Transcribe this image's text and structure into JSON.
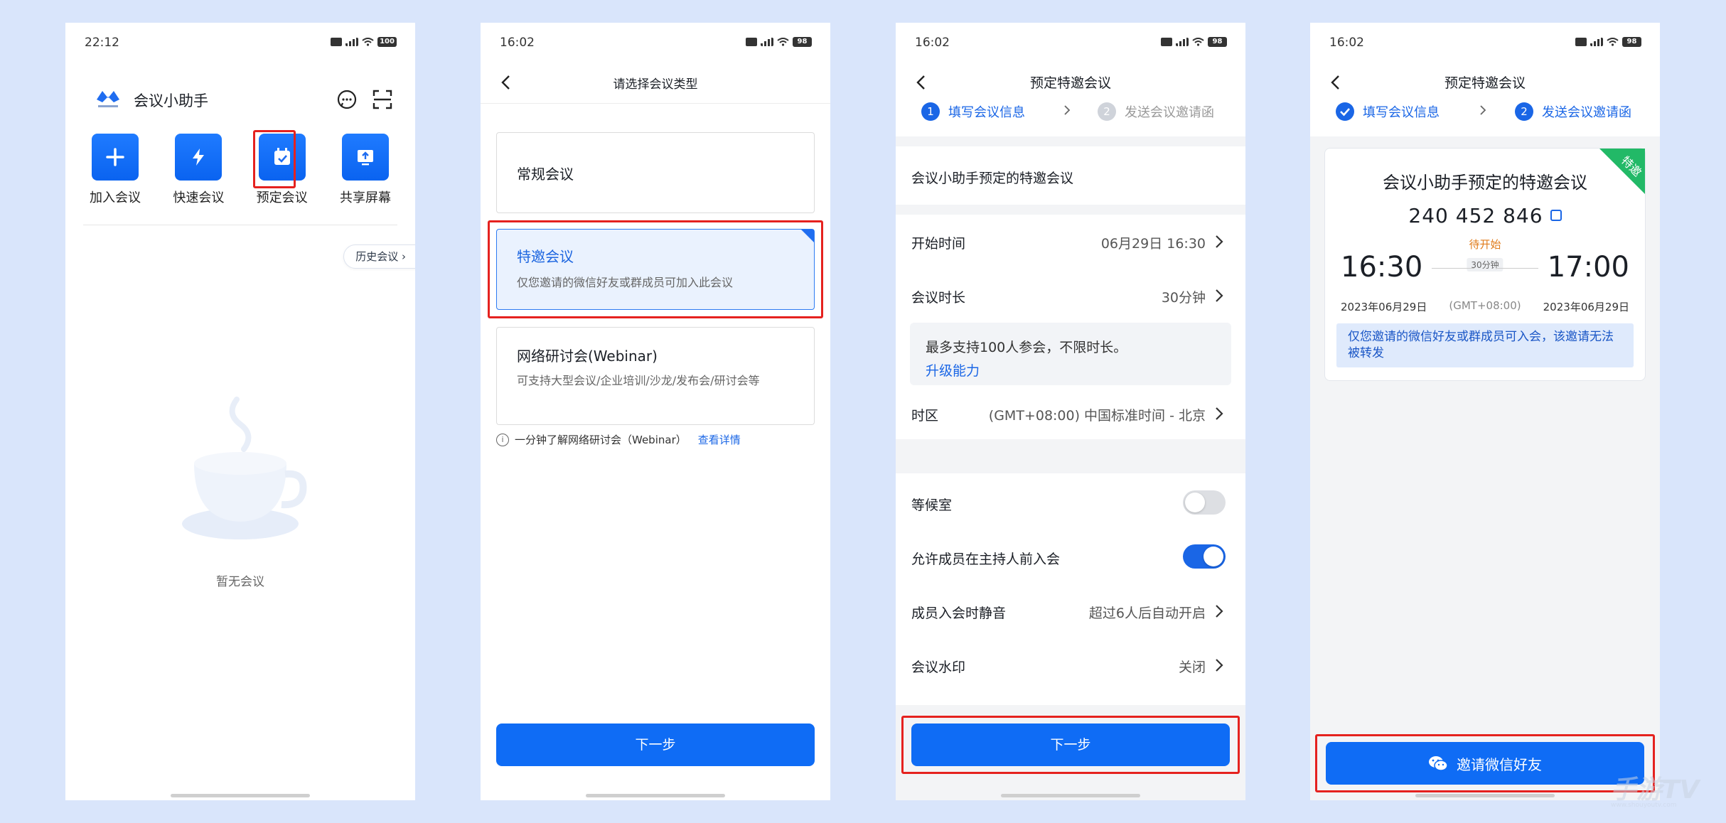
{
  "colors": {
    "page_bg": "#d9e5fb",
    "accent": "#0f6cf5",
    "highlight_border": "#e5221f",
    "special_tag": "#22b967"
  },
  "screen1": {
    "status": {
      "time": "22:12",
      "battery": "100"
    },
    "app_title": "会议小助手",
    "actions": [
      {
        "label": "加入会议",
        "icon": "plus-icon"
      },
      {
        "label": "快速会议",
        "icon": "lightning-icon"
      },
      {
        "label": "预定会议",
        "icon": "calendar-check-icon"
      },
      {
        "label": "共享屏幕",
        "icon": "share-screen-icon"
      }
    ],
    "history_button": "历史会议",
    "empty_text": "暂无会议"
  },
  "screen2": {
    "status": {
      "time": "16:02",
      "battery": "98"
    },
    "title": "请选择会议类型",
    "types": [
      {
        "title": "常规会议",
        "desc": ""
      },
      {
        "title": "特邀会议",
        "desc": "仅您邀请的微信好友或群成员可加入此会议"
      },
      {
        "title": "网络研讨会(Webinar)",
        "desc": "可支持大型会议/企业培训/沙龙/发布会/研讨会等"
      }
    ],
    "info_text": "一分钟了解网络研讨会（Webinar）",
    "info_link": "查看详情",
    "next_button": "下一步"
  },
  "screen3": {
    "status": {
      "time": "16:02",
      "battery": "98"
    },
    "title": "预定特邀会议",
    "steps": [
      {
        "num": "1",
        "label": "填写会议信息"
      },
      {
        "num": "2",
        "label": "发送会议邀请函"
      }
    ],
    "meeting_name": "会议小助手预定的特邀会议",
    "start_time": {
      "label": "开始时间",
      "value": "06月29日 16:30"
    },
    "duration": {
      "label": "会议时长",
      "value": "30分钟"
    },
    "tip": {
      "text": "最多支持100人参会，不限时长。",
      "link": "升级能力"
    },
    "timezone": {
      "label": "时区",
      "value": "(GMT+08:00) 中国标准时间 - 北京"
    },
    "waiting_room": {
      "label": "等候室",
      "on": false
    },
    "join_before_host": {
      "label": "允许成员在主持人前入会",
      "on": true
    },
    "mute_on_join": {
      "label": "成员入会时静音",
      "value": "超过6人后自动开启"
    },
    "watermark": {
      "label": "会议水印",
      "value": "关闭"
    },
    "next_button": "下一步"
  },
  "screen4": {
    "status": {
      "time": "16:02",
      "battery": "98"
    },
    "title": "预定特邀会议",
    "steps": [
      {
        "label": "填写会议信息"
      },
      {
        "num": "2",
        "label": "发送会议邀请函"
      }
    ],
    "card": {
      "badge": "特邀",
      "title": "会议小助手预定的特邀会议",
      "meeting_id": "240 452 846",
      "status": "待开始",
      "duration": "30分钟",
      "start_time": "16:30",
      "end_time": "17:00",
      "start_date": "2023年06月29日",
      "end_date": "2023年06月29日",
      "timezone": "(GMT+08:00)",
      "notice": "仅您邀请的微信好友或群成员可入会，该邀请无法被转发"
    },
    "invite_button": "邀请微信好友"
  },
  "watermark": {
    "main": "手游TV",
    "sub": "www.shouyoutv.com"
  }
}
